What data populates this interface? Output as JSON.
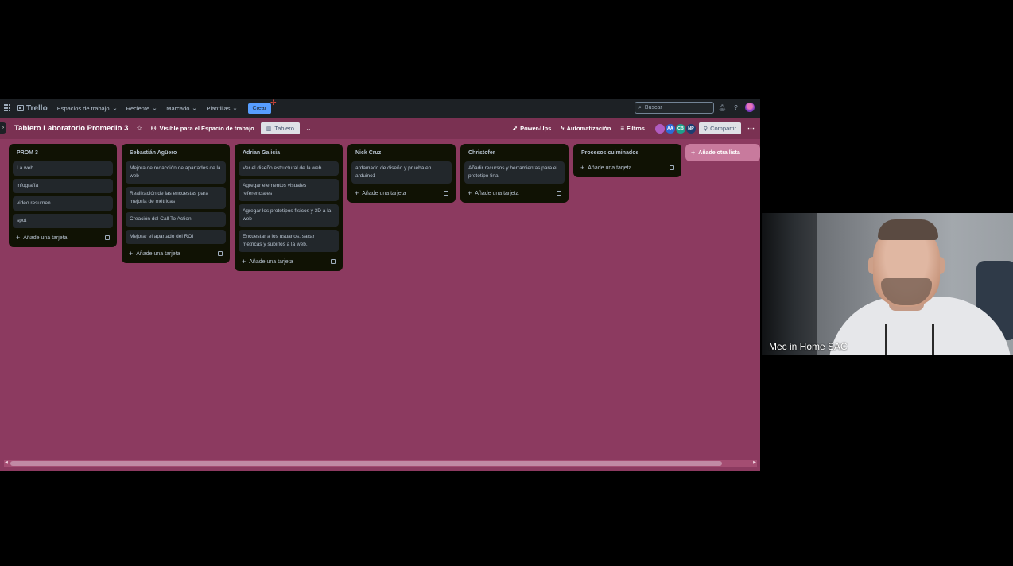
{
  "topnav": {
    "logo": "Trello",
    "items": [
      {
        "label": "Espacios de trabajo"
      },
      {
        "label": "Reciente"
      },
      {
        "label": "Marcado"
      },
      {
        "label": "Plantillas"
      }
    ],
    "create_label": "Crear",
    "search_placeholder": "Buscar"
  },
  "board": {
    "title": "Tablero Laboratorio Promedio 3",
    "visibility": "Visible para el Espacio de trabajo",
    "view": "Tablero",
    "powerups": "Power-Ups",
    "automation": "Automatización",
    "filters": "Filtros",
    "members": [
      {
        "initials": "",
        "color": "#b05cc0"
      },
      {
        "initials": "AA",
        "color": "#2d6ad6"
      },
      {
        "initials": "CB",
        "color": "#1f9f8a"
      },
      {
        "initials": "NP",
        "color": "#1d3d70"
      }
    ],
    "share": "Compartir"
  },
  "add_card_label": "Añade una tarjeta",
  "add_list_label": "Añade otra lista",
  "lists": [
    {
      "title": "PROM 3",
      "cards": [
        "La web",
        "infografía",
        "video resumen",
        "spot"
      ]
    },
    {
      "title": "Sebastián Agüero",
      "cards": [
        "Mejora de redacción de apartados de la web",
        "Realización de las encuestas para mejoría de métricas",
        "Creación del Call To Action",
        "Mejorar el apartado del ROI"
      ]
    },
    {
      "title": "Adrian Galicia",
      "cards": [
        "Ver el diseño estructural de la web",
        "Agregar elementos visuales referenciales",
        "Agregar los prototipos físicos y 3D a la web",
        "Encuestar a los usuarios, sacar métricas y subirlos a la web."
      ]
    },
    {
      "title": "Nick Cruz",
      "cards": [
        "ardamado de diseño y prueba en arduino1"
      ]
    },
    {
      "title": "Christofer",
      "cards": [
        "Añadir recursos y herramientas para el prototipo final"
      ]
    },
    {
      "title": "Procesos culminados",
      "cards": []
    }
  ],
  "webcam": {
    "name": "Mec in Home SAC"
  }
}
